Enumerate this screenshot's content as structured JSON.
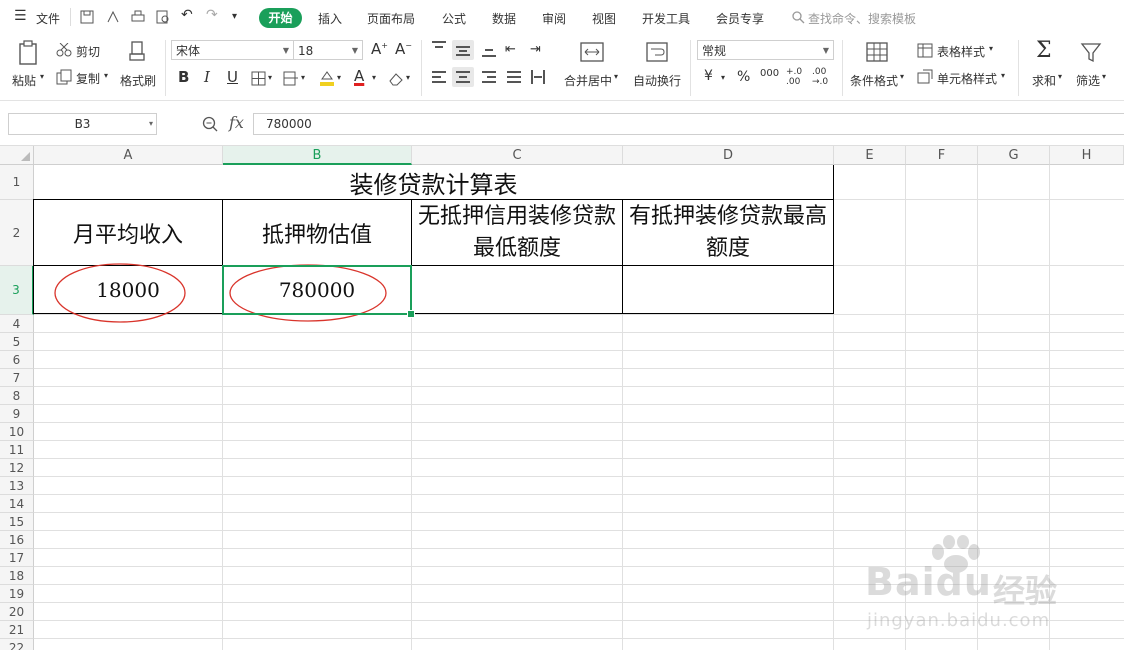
{
  "menu": {
    "file_label": "文件",
    "tabs": [
      "开始",
      "插入",
      "页面布局",
      "公式",
      "数据",
      "审阅",
      "视图",
      "开发工具",
      "会员专享"
    ],
    "search_placeholder": "查找命令、搜索模板"
  },
  "ribbon": {
    "paste": "粘贴",
    "cut": "剪切",
    "copy": "复制",
    "format_painter": "格式刷",
    "font_name": "宋体",
    "font_size": "18",
    "merge_center": "合并居中",
    "wrap_text": "自动换行",
    "number_format": "常规",
    "currency_symbol": "¥",
    "percent_symbol": "%",
    "thousands_symbol": "000",
    "cond_format": "条件格式",
    "table_style": "表格样式",
    "cell_style": "单元格样式",
    "sum": "求和",
    "filter": "筛选"
  },
  "formula_bar": {
    "name_box": "B3",
    "fx": "fx",
    "value": "780000"
  },
  "columns": [
    "A",
    "B",
    "C",
    "D",
    "E",
    "F",
    "G",
    "H"
  ],
  "rows": [
    "1",
    "2",
    "3",
    "4",
    "5",
    "6",
    "7",
    "8",
    "9",
    "10",
    "11",
    "12",
    "13",
    "14",
    "15",
    "16",
    "17",
    "18",
    "19",
    "20",
    "21",
    "22"
  ],
  "sheet": {
    "title": "装修贷款计算表",
    "headers": [
      "月平均收入",
      "抵押物估值",
      "无抵押信用装修贷款最低额度",
      "有抵押装修贷款最高额度"
    ],
    "values": [
      "18000",
      "780000",
      "",
      ""
    ]
  },
  "watermark": {
    "brand": "Baidu",
    "brand_cn": "经验",
    "url": "jingyan.baidu.com"
  },
  "colors": {
    "accent_green": "#1a9f5a",
    "annotation_red": "#d9342b"
  }
}
